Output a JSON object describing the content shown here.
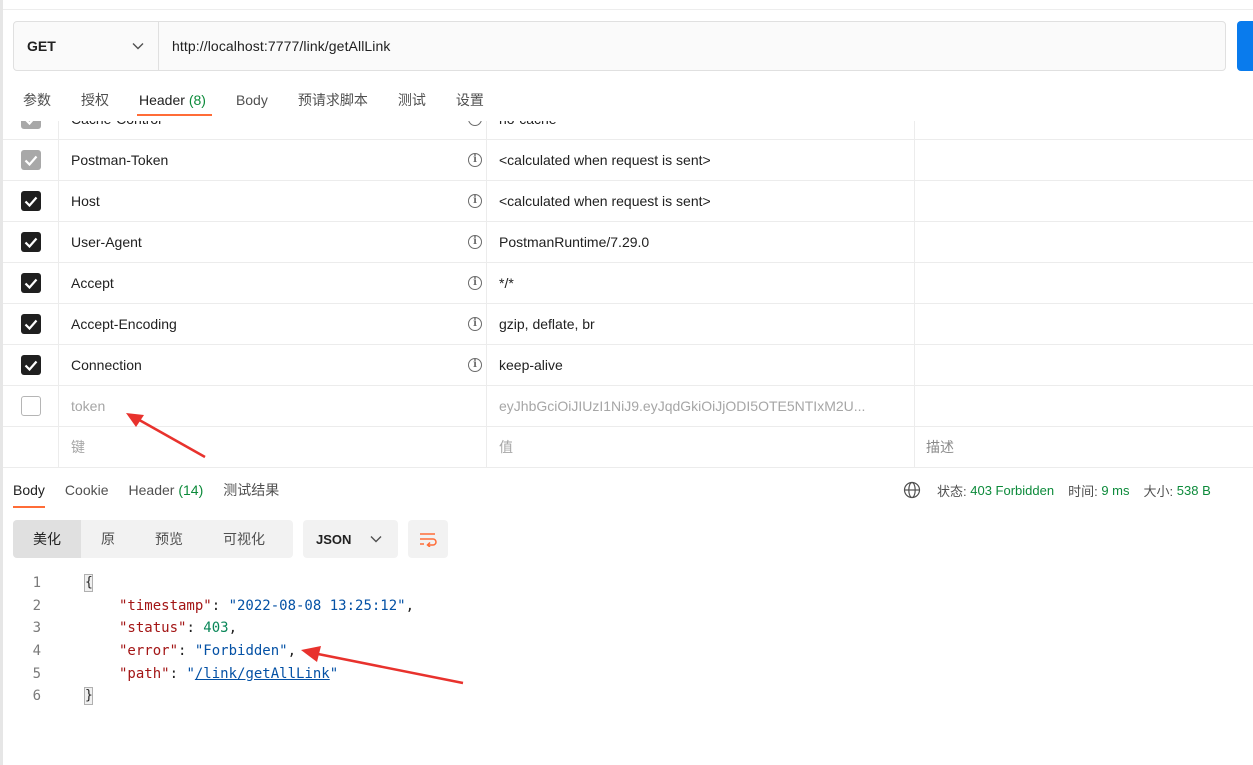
{
  "request": {
    "method": "GET",
    "url": "http://localhost:7777/link/getAllLink"
  },
  "request_tabs": [
    {
      "label": "参数"
    },
    {
      "label": "授权"
    },
    {
      "label": "Header",
      "count": "(8)"
    },
    {
      "label": "Body"
    },
    {
      "label": "预请求脚本"
    },
    {
      "label": "测试"
    },
    {
      "label": "设置"
    }
  ],
  "headers": {
    "partial_row": {
      "key": "Cache-Control",
      "value": "no-cache"
    },
    "rows": [
      {
        "key": "Postman-Token",
        "value": "<calculated when request is sent>",
        "checked": "grey"
      },
      {
        "key": "Host",
        "value": "<calculated when request is sent>",
        "checked": "true"
      },
      {
        "key": "User-Agent",
        "value": "PostmanRuntime/7.29.0",
        "checked": "true"
      },
      {
        "key": "Accept",
        "value": "*/*",
        "checked": "true"
      },
      {
        "key": "Accept-Encoding",
        "value": "gzip, deflate, br",
        "checked": "true"
      },
      {
        "key": "Connection",
        "value": "keep-alive",
        "checked": "true"
      }
    ],
    "disabled_row": {
      "key": "token",
      "value": "eyJhbGciOiJIUzI1NiJ9.eyJqdGkiOiJjODI5OTE5NTIxM2U...",
      "checked": "false"
    },
    "placeholders": {
      "key": "键",
      "value": "值",
      "description": "描述"
    }
  },
  "response_tabs": [
    {
      "label": "Body"
    },
    {
      "label": "Cookie"
    },
    {
      "label": "Header",
      "count": "(14)"
    },
    {
      "label": "测试结果"
    }
  ],
  "response_meta": {
    "status_label": "状态:",
    "status_value": "403 Forbidden",
    "time_label": "时间:",
    "time_value": "9 ms",
    "size_label": "大小:",
    "size_value": "538 B"
  },
  "view_modes": [
    "美化",
    "原",
    "预览",
    "可视化"
  ],
  "format": "JSON",
  "body_json": {
    "line_numbers": [
      "1",
      "2",
      "3",
      "4",
      "5",
      "6"
    ],
    "open_brace": "{",
    "close_brace": "}",
    "fields": [
      {
        "key": "\"timestamp\"",
        "value": "\"2022-08-08 13:25:12\"",
        "type": "string",
        "trailing": ","
      },
      {
        "key": "\"status\"",
        "value": "403",
        "type": "number",
        "trailing": ","
      },
      {
        "key": "\"error\"",
        "value": "\"Forbidden\"",
        "type": "string",
        "trailing": ","
      },
      {
        "key": "\"path\"",
        "value": "/link/getAllLink",
        "type": "link",
        "trailing": ""
      }
    ]
  },
  "colors": {
    "accent": "#ff6c37",
    "send_button": "#097bed",
    "success_green": "#0c8a3a",
    "annotation_arrow": "#e8322d"
  },
  "icons": {
    "method_dropdown": "chevron-down-icon",
    "info": "info-icon",
    "globe": "globe-icon",
    "wrap": "wrap-lines-icon"
  }
}
